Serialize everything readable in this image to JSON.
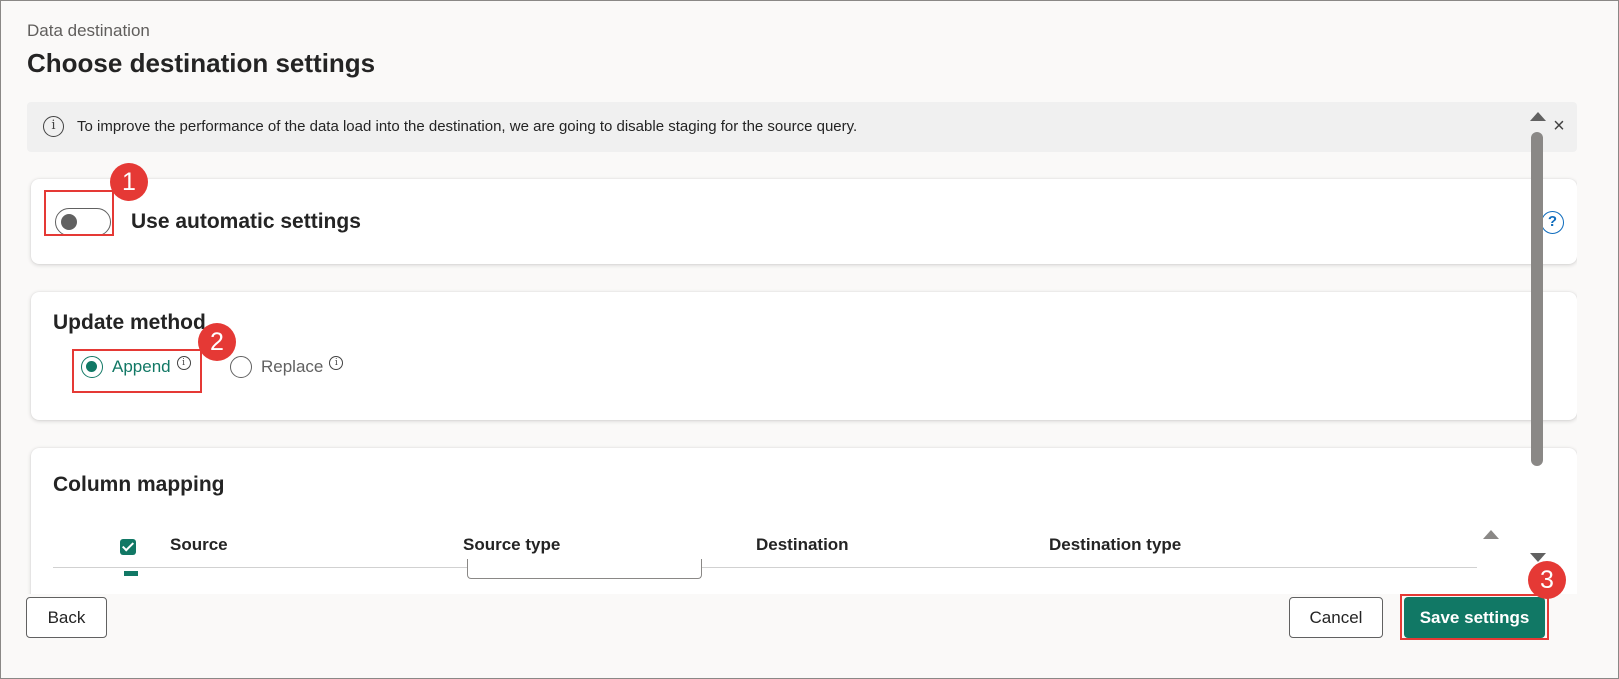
{
  "header": {
    "breadcrumb": "Data destination",
    "title": "Choose destination settings"
  },
  "info_bar": {
    "icon": "info-icon",
    "message": "To improve the performance of the data load into the destination, we are going to disable staging for the source query.",
    "close_icon": "×"
  },
  "automatic_settings": {
    "label": "Use automatic settings",
    "toggle_on": false,
    "help_icon": "?"
  },
  "update_method": {
    "title": "Update method",
    "options": [
      {
        "label": "Append",
        "selected": true,
        "info": "i"
      },
      {
        "label": "Replace",
        "selected": false,
        "info": "i"
      }
    ]
  },
  "column_mapping": {
    "title": "Column mapping",
    "columns": [
      "Source",
      "Source type",
      "Destination",
      "Destination type"
    ],
    "select_all_checked": true
  },
  "footer": {
    "back_label": "Back",
    "cancel_label": "Cancel",
    "save_label": "Save settings"
  },
  "annotations": {
    "step1": "1",
    "step2": "2",
    "step3": "3",
    "highlight_color": "#e53935"
  },
  "colors": {
    "accent": "#117865",
    "link": "#0f6cbd"
  }
}
